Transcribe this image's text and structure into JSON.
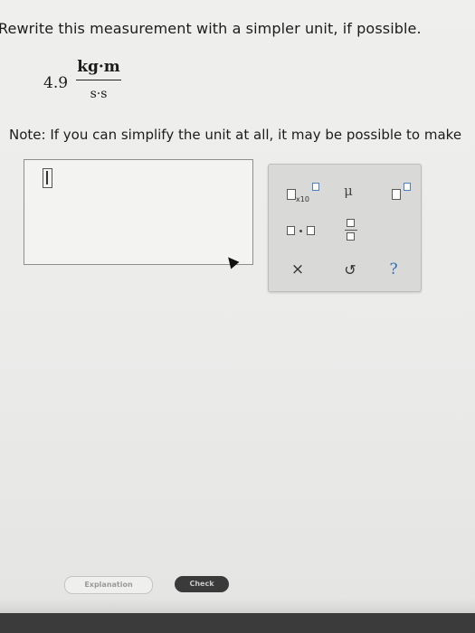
{
  "question": {
    "prompt": "Rewrite this measurement with a simpler unit, if possible."
  },
  "measurement": {
    "value": "4.9",
    "numerator_unit": "kg·m",
    "denominator_unit": "s·s"
  },
  "note": "Note: If you can simplify the unit at all, it may be possible to make",
  "palette": {
    "x10_label": "x10",
    "mu_label": "μ",
    "clear_label": "×",
    "undo_label": "↺",
    "help_label": "?"
  },
  "buttons": {
    "explanation_label": "Explanation",
    "check_label": "Check"
  },
  "colors": {
    "background": "#ebebea",
    "palette_bg": "#d9d9d7",
    "help_blue": "#2f6fb6",
    "check_bg": "#3a3a3a"
  }
}
